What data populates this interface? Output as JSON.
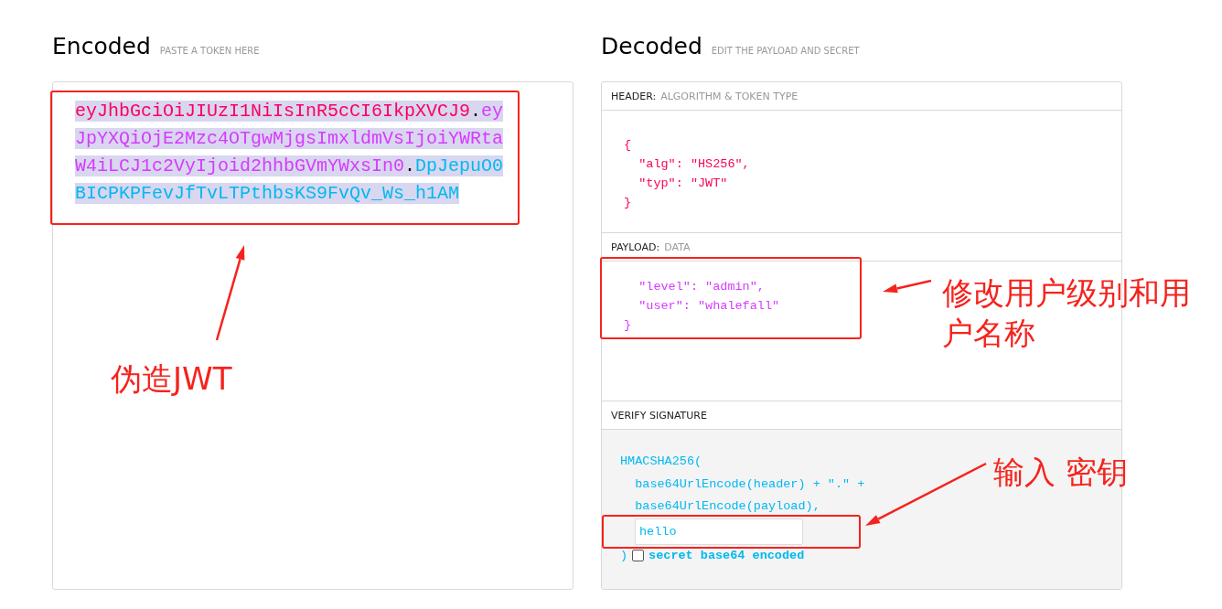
{
  "encoded": {
    "title": "Encoded",
    "hint": "PASTE A TOKEN HERE",
    "selected": true,
    "token": [
      {
        "text": "eyJhbGciOiJIUzI1NiIsInR5cCI6IkpXVCJ9",
        "kind": "header"
      },
      {
        "text": ".",
        "kind": "dot"
      },
      {
        "text": "eyJpYXQiOjE2Mzc4OTgwMjgsImxldmVsIjoiYWRtaW4iLCJ1c2VyIjoid2hhbGVmYWxsIn0",
        "kind": "payload"
      },
      {
        "text": ".",
        "kind": "dot"
      },
      {
        "text": "DpJepuO0BICPKPFevJfTvLTPthbsKS9FvQv_Ws_h1AM",
        "kind": "signature"
      }
    ]
  },
  "decoded": {
    "title": "Decoded",
    "hint": "EDIT THE PAYLOAD AND SECRET",
    "sections": [
      {
        "kind": "header",
        "label": "HEADER:",
        "hint": "ALGORITHM & TOKEN TYPE",
        "lines": [
          "{",
          "  \"alg\": \"HS256\",",
          "  \"typ\": \"JWT\"",
          "}"
        ]
      },
      {
        "kind": "payload",
        "label": "PAYLOAD:",
        "hint": "DATA",
        "lines": [
          "  \"level\": \"admin\",",
          "  \"user\": \"whalefall\"",
          "}"
        ]
      },
      {
        "kind": "verify",
        "label": "VERIFY SIGNATURE",
        "lines": [
          "HMACSHA256(",
          "  base64UrlEncode(header) + \".\" +",
          "  base64UrlEncode(payload),"
        ],
        "secret": "hello",
        "close": ")",
        "checkbox": {
          "label": "secret base64 encoded",
          "checked": false
        }
      }
    ]
  },
  "annotations": [
    {
      "kind": "token",
      "text": "伪造JWT"
    },
    {
      "kind": "payload",
      "text": "修改用户级别和用户名称"
    },
    {
      "kind": "secret",
      "text": "输入 密钥"
    }
  ]
}
